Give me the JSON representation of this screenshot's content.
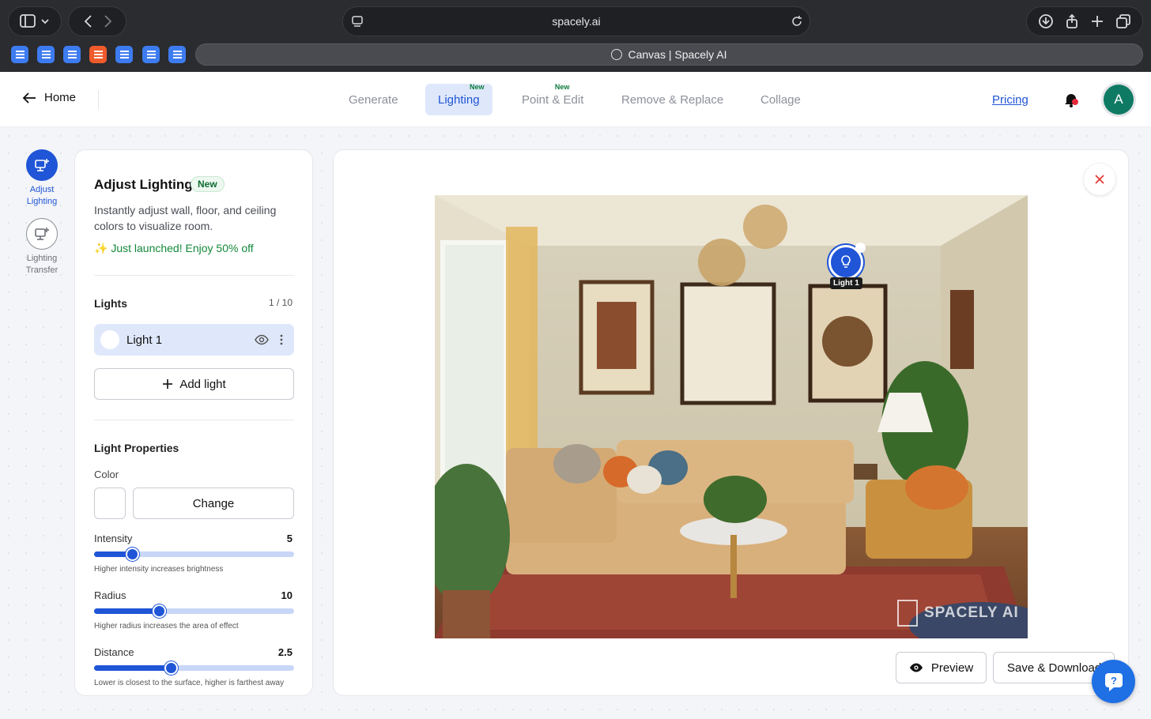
{
  "browser": {
    "url": "spacely.ai",
    "tab_title": "Canvas | Spacely AI"
  },
  "header": {
    "home_label": "Home",
    "nav": [
      {
        "label": "Generate",
        "badge": ""
      },
      {
        "label": "Lighting",
        "badge": "New"
      },
      {
        "label": "Point & Edit",
        "badge": "New"
      },
      {
        "label": "Remove & Replace",
        "badge": ""
      },
      {
        "label": "Collage",
        "badge": ""
      }
    ],
    "pricing_label": "Pricing",
    "avatar_letter": "A"
  },
  "tools": [
    {
      "label_line1": "Adjust",
      "label_line2": "Lighting",
      "active": true
    },
    {
      "label_line1": "Lighting",
      "label_line2": "Transfer",
      "active": false
    }
  ],
  "panel": {
    "title": "Adjust Lighting",
    "title_badge": "New",
    "description": "Instantly adjust wall, floor, and ceiling colors to visualize room.",
    "promo": "✨ Just launched! Enjoy 50% off",
    "lights_label": "Lights",
    "lights_count": "1 / 10",
    "lights": [
      {
        "name": "Light 1"
      }
    ],
    "add_light_label": "Add light",
    "properties_label": "Light Properties",
    "color_label": "Color",
    "change_label": "Change",
    "sliders": [
      {
        "label": "Intensity",
        "value": "5",
        "fraction": 0.19,
        "hint": "Higher intensity increases brightness"
      },
      {
        "label": "Radius",
        "value": "10",
        "fraction": 0.325,
        "hint": "Higher radius increases the area of effect"
      },
      {
        "label": "Distance",
        "value": "2.5",
        "fraction": 0.385,
        "hint": "Lower is closest to the surface, higher is farthest away"
      }
    ]
  },
  "canvas": {
    "marker_label": "Light 1",
    "watermark": "SPACELY AI",
    "preview_label": "Preview",
    "save_label": "Save & Download"
  },
  "colors": {
    "accent": "#1f55d6",
    "accent_light": "#dfe8fb",
    "promo_green": "#14893a",
    "close_red": "#e53935"
  }
}
